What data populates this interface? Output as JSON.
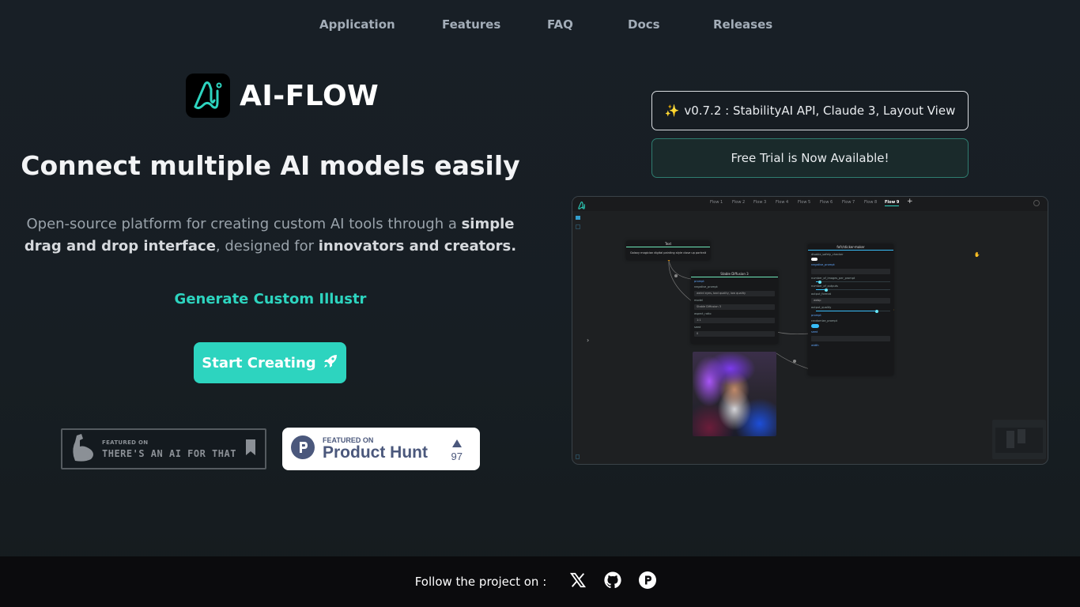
{
  "nav": {
    "items": [
      {
        "label": "Application"
      },
      {
        "label": "Features"
      },
      {
        "label": "FAQ"
      },
      {
        "label": "Docs"
      },
      {
        "label": "Releases"
      }
    ]
  },
  "hero": {
    "brand_name": "AI-FLOW",
    "logo_icon": "ai-flow-logo",
    "headline": "Connect multiple AI models easily",
    "description": {
      "part1": "Open-source platform for creating custom AI tools through a ",
      "bold1": "simple drag and drop interface",
      "part2": ", designed for ",
      "bold2": "innovators and creators."
    },
    "typed_text": "Generate Custom Illustr",
    "start_button": {
      "label": "Start Creating",
      "icon": "rocket-icon"
    },
    "accent_color": "#2dd4bf"
  },
  "badges": {
    "taaft": {
      "small": "FEATURED ON",
      "big": "THERE'S AN AI FOR THAT"
    },
    "product_hunt": {
      "small": "FEATURED ON",
      "big": "Product Hunt",
      "upvotes": "97"
    }
  },
  "announcements": {
    "release": {
      "emoji": "✨",
      "text": "v0.7.2 : StabilityAI API, Claude 3, Layout View"
    },
    "trial": {
      "text": "Free Trial is Now Available!"
    }
  },
  "preview": {
    "tabs": [
      "Flow 1",
      "Flow 2",
      "Flow 3",
      "Flow 4",
      "Flow 5",
      "Flow 6",
      "Flow 7",
      "Flow 8",
      "Flow 9"
    ],
    "active_tab": "Flow 9",
    "add_tab": "+",
    "text_node": {
      "title": "Text",
      "content": "Galaxy magician digital painting style close up portrait"
    },
    "sd_node": {
      "title": "Stable Diffusion 3",
      "fields": [
        {
          "label": "prompt"
        },
        {
          "label": "negative_prompt",
          "value": "weird eyes, bad quality, low quality"
        },
        {
          "label": "model",
          "value": "Stable Diffusion 3"
        },
        {
          "label": "aspect_ratio",
          "value": "1:1"
        },
        {
          "label": "seed",
          "value": "0"
        }
      ]
    },
    "dalle_node": {
      "title": "fofr/sticker-maker",
      "fields": [
        {
          "label": "disable_safety_checker"
        },
        {
          "label": "negative_prompt"
        },
        {
          "label": "number_of_images_per_prompt"
        },
        {
          "label": "number_of_outputs"
        },
        {
          "label": "output_format",
          "value": "webp"
        },
        {
          "label": "output_quality"
        },
        {
          "label": "prompt"
        },
        {
          "label": "randomize_prompt"
        },
        {
          "label": "seed"
        },
        {
          "label": "width"
        }
      ]
    }
  },
  "footer": {
    "label": "Follow the project on :",
    "links": [
      {
        "icon": "x-twitter-icon"
      },
      {
        "icon": "github-icon"
      },
      {
        "icon": "product-hunt-icon"
      }
    ]
  }
}
